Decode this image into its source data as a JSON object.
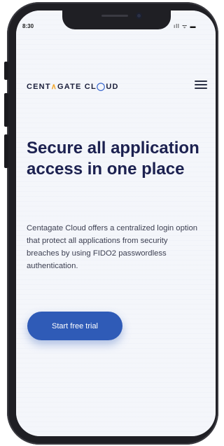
{
  "status": {
    "time": "8:30",
    "icons": "ıll ᯤ ▬"
  },
  "logo": {
    "part1": "CENT",
    "part2": "∧",
    "part3": "GATE CL",
    "part4": "◯",
    "part5": "UD"
  },
  "hero": {
    "title": "Secure all application access in one place"
  },
  "description": "Centagate Cloud offers a centralized login option that protect all applications from security breaches by using FIDO2 passwordless authentication.",
  "cta": {
    "label": "Start free trial"
  }
}
